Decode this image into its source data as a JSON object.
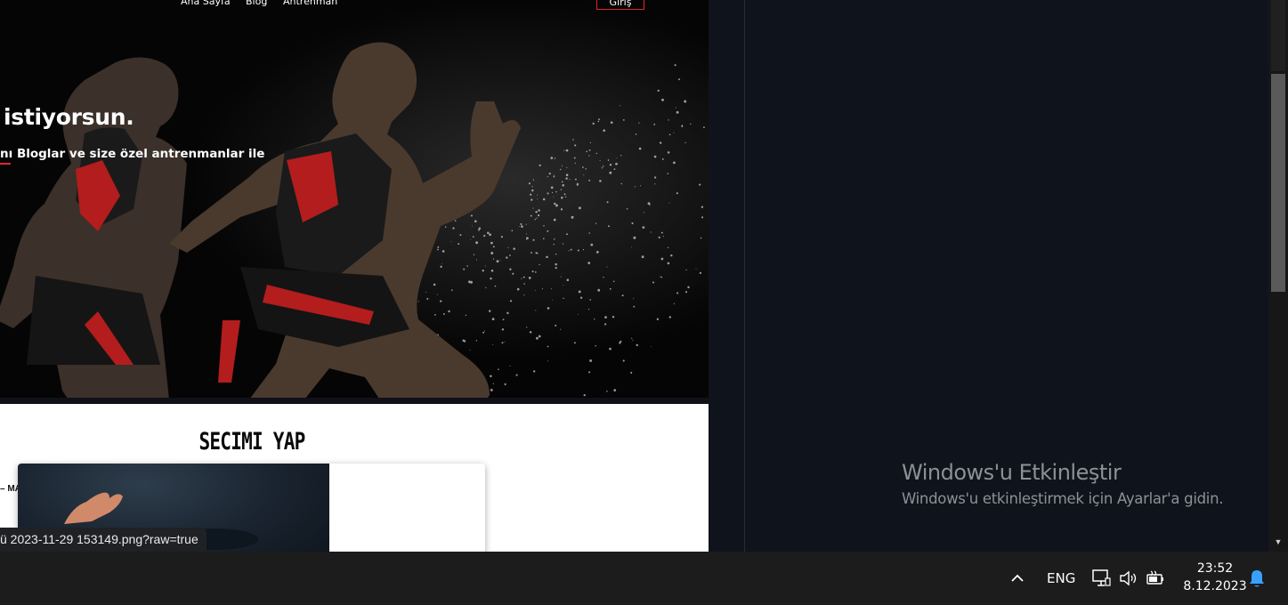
{
  "site": {
    "nav": {
      "links": [
        "Ana Sayfa",
        "Blog",
        "Antrenman"
      ],
      "login_label": "Giriş"
    },
    "hero": {
      "headline": "istiyorsun.",
      "subtext": "nı Bloglar ve size özel antrenmanlar ile"
    },
    "section": {
      "title": "SECIMI YAP",
      "side_fragment": "– MA"
    }
  },
  "browser": {
    "status_url": "ü 2023-11-29 153149.png?raw=true"
  },
  "activation": {
    "title": "Windows'u Etkinleştir",
    "subtitle": "Windows'u etkinleştirmek için Ayarlar'a gidin."
  },
  "taskbar": {
    "language": "ENG",
    "time": "23:52",
    "date": "8.12.2023",
    "tray_icons": [
      "chevron-up-icon",
      "network-icon",
      "volume-icon",
      "battery-icon",
      "notification-bell-icon"
    ]
  },
  "colors": {
    "accent_red": "#e3252a",
    "taskbar_bg": "#1c1c1c",
    "panel_bg": "#0f131c",
    "bell_blue": "#3aa0ff"
  }
}
